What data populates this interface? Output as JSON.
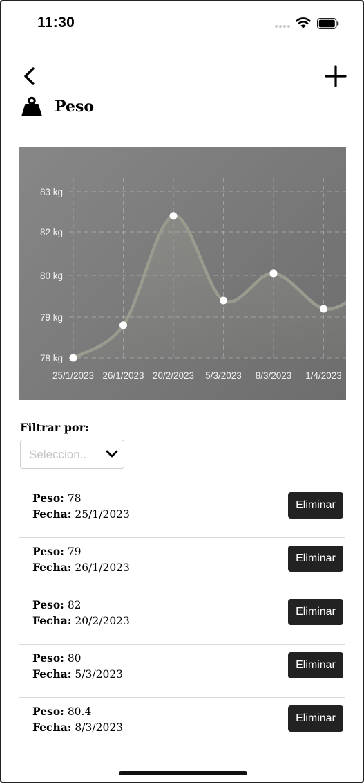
{
  "status_bar": {
    "time": "11:30"
  },
  "header": {
    "title": "Peso",
    "icons": {
      "back": "chevron-left-icon",
      "add": "plus-icon",
      "category": "weight-icon"
    }
  },
  "chart_data": {
    "type": "line",
    "categories": [
      "25/1/2023",
      "26/1/2023",
      "20/2/2023",
      "5/3/2023",
      "8/3/2023",
      "1/4/2023"
    ],
    "values": [
      78,
      78.8,
      82.4,
      79.4,
      80.1,
      79.2
    ],
    "y_ticks": [
      "83 kg",
      "82 kg",
      "80 kg",
      "79 kg",
      "78 kg"
    ],
    "ylabel": "",
    "xlabel": "",
    "title": "",
    "grid": true
  },
  "filter": {
    "label": "Filtrar por:",
    "placeholder": "Seleccion..."
  },
  "records": [
    {
      "peso_label": "Peso:",
      "peso": " 78",
      "fecha_label": "Fecha:",
      "fecha": " 25/1/2023",
      "delete_label": "Eliminar"
    },
    {
      "peso_label": "Peso:",
      "peso": " 79",
      "fecha_label": "Fecha:",
      "fecha": " 26/1/2023",
      "delete_label": "Eliminar"
    },
    {
      "peso_label": "Peso:",
      "peso": " 82",
      "fecha_label": "Fecha:",
      "fecha": " 20/2/2023",
      "delete_label": "Eliminar"
    },
    {
      "peso_label": "Peso:",
      "peso": " 80",
      "fecha_label": "Fecha:",
      "fecha": " 5/3/2023",
      "delete_label": "Eliminar"
    },
    {
      "peso_label": "Peso:",
      "peso": " 80.4",
      "fecha_label": "Fecha:",
      "fecha": " 8/3/2023",
      "delete_label": "Eliminar"
    }
  ]
}
